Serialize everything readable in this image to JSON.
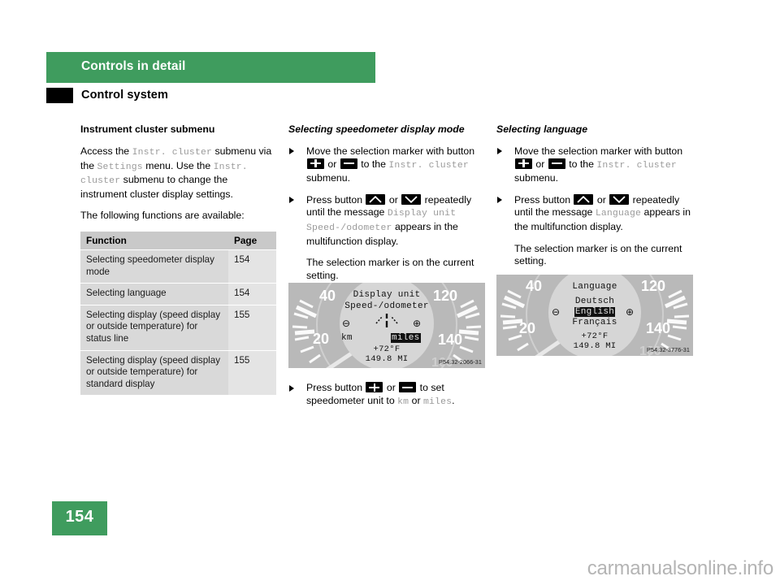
{
  "header": {
    "chapter": "Controls in detail",
    "section": "Control system"
  },
  "footer": {
    "page_number": "154",
    "watermark": "carmanualsonline.info"
  },
  "colors": {
    "brand_green": "#3f9c5e",
    "table_header": "#c9c9c9",
    "table_row_function": "#d9d9d9",
    "table_row_page": "#e4e4e4",
    "mono_text": "#9a9a9a"
  },
  "left_column": {
    "heading": "Instrument cluster submenu",
    "paragraph1": {
      "part1": "Access the ",
      "mono1": "Instr. cluster",
      "part2": " submenu via the ",
      "mono2": "Settings",
      "part3": " menu. Use the ",
      "mono3": "Instr. cluster",
      "part4": " submenu to change the instrument cluster display settings."
    },
    "paragraph2": "The following functions are available:",
    "table": {
      "columns": [
        "Function",
        "Page"
      ],
      "rows": [
        {
          "function": "Selecting speedometer display mode",
          "page": "154"
        },
        {
          "function": "Selecting language",
          "page": "154"
        },
        {
          "function": "Selecting display (speed display or outside temperature) for status line",
          "page": "155"
        },
        {
          "function": "Selecting display (speed display or outside temperature) for standard display",
          "page": "155"
        }
      ]
    }
  },
  "middle_column": {
    "heading": "Selecting speedometer display mode",
    "bullet1": {
      "text_before_key1": "Move the selection marker with button ",
      "key1": "plus-button",
      "text_between": " or ",
      "key2": "minus-button",
      "text_after": " to the ",
      "mono": "Instr. cluster",
      "tail": " submenu."
    },
    "bullet2": {
      "text_before_key1": "Press button ",
      "key1": "up-arrow-button",
      "text_between": " or ",
      "key2": "down-arrow-button",
      "text_after": " repeatedly until the message ",
      "mono": "Display unit Speed-/odometer",
      "tail": " appears in the multifunction display."
    },
    "note": "The selection marker is on the current setting.",
    "illustration": {
      "id_tag": "P54.32-2066-31",
      "gauge_labels": [
        "40",
        "20",
        "120",
        "140"
      ],
      "mfd_line1": "Display unit",
      "mfd_line2": "Speed-/odometer",
      "option_left": "km",
      "option_right": "miles",
      "selected_option": "miles",
      "minus_symbol": "⊖",
      "plus_symbol": "⊕",
      "status_temp": "+72°F",
      "status_odo": "149.8 MI"
    },
    "bullet3": {
      "text_before_key1": "Press button ",
      "key1": "plus-button",
      "text_between": " or ",
      "key2": "minus-button",
      "text_after": " to set speedometer unit to ",
      "mono1": "km",
      "mid": " or ",
      "mono2": "miles",
      "tail": "."
    }
  },
  "right_column": {
    "heading": "Selecting language",
    "bullet1": {
      "text_before_key1": "Move the selection marker with button ",
      "key1": "plus-button",
      "text_between": " or ",
      "key2": "minus-button",
      "text_after": " to the ",
      "mono": "Instr. cluster",
      "tail": " submenu."
    },
    "bullet2": {
      "text_before_key1": "Press button ",
      "key1": "up-arrow-button",
      "text_between": " or ",
      "key2": "down-arrow-button",
      "text_after": " repeatedly until the message ",
      "mono": "Language",
      "tail": " appears in the multifunction display."
    },
    "note": "The selection marker is on the current setting.",
    "illustration": {
      "id_tag": "P54.32-3776-31",
      "gauge_labels": [
        "40",
        "20",
        "120",
        "140"
      ],
      "mfd_title": "Language",
      "options": [
        "Deutsch",
        "English",
        "Français"
      ],
      "selected_option": "English",
      "minus_symbol": "⊖",
      "plus_symbol": "⊕",
      "status_temp": "+72°F",
      "status_odo": "149.8 MI"
    }
  }
}
